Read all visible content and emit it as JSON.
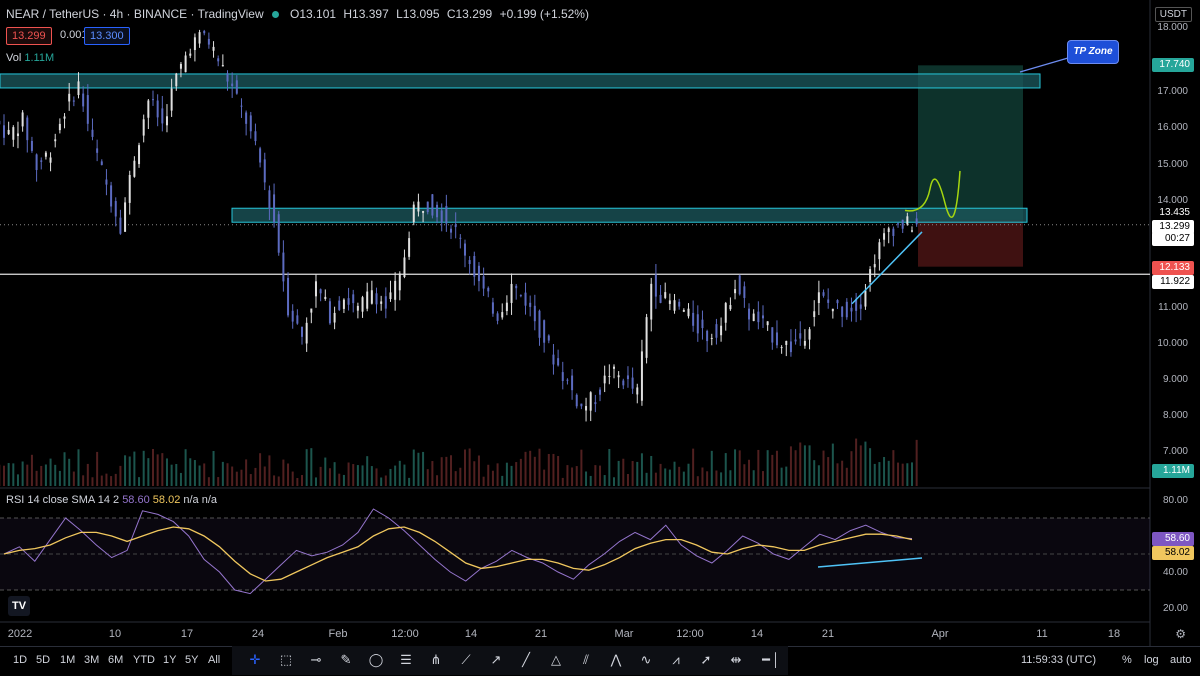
{
  "header": {
    "symbol": "NEAR / TetherUS · 4h · BINANCE · TradingView",
    "open": "O13.101",
    "high": "H13.397",
    "low": "L13.095",
    "close": "C13.299",
    "change": "+0.199 (+1.52%)",
    "sell_price": "13.299",
    "spread": "0.001",
    "buy_price": "13.300",
    "vol_label": "Vol",
    "vol_value": "1.11M",
    "currency": "USDT"
  },
  "rsi": {
    "label": "RSI 14 close SMA 14 2",
    "value": "58.60",
    "sma": "58.02",
    "extra": "n/a n/a"
  },
  "price_axis": [
    "18.000",
    "17.000",
    "16.000",
    "15.000",
    "14.000",
    "11.000",
    "10.000",
    "9.000",
    "8.000",
    "7.000"
  ],
  "rsi_axis": [
    "80.00",
    "40.00",
    "20.00"
  ],
  "price_tags": {
    "tp": "17.740",
    "entry": "13.435",
    "current": "13.299",
    "countdown": "00:27",
    "stop": "12.133",
    "support": "11.922",
    "volume": "1.11M",
    "rsi_value": "58.60",
    "rsi_sma": "58.02"
  },
  "time_axis": [
    "2022",
    "10",
    "17",
    "24",
    "Feb",
    "12:00",
    "14",
    "21",
    "Mar",
    "12:00",
    "14",
    "21",
    "Apr",
    "11",
    "18"
  ],
  "annotation": "TP Zone",
  "toolbar": {
    "timeframes": [
      "1D",
      "5D",
      "1M",
      "3M",
      "6M",
      "YTD",
      "1Y",
      "5Y",
      "All"
    ],
    "clock": "11:59:33 (UTC)",
    "percent": "%",
    "log": "log",
    "auto": "auto"
  },
  "colors": {
    "up": "#26a69a",
    "down": "#5c6bc0",
    "zone": "#26c6da",
    "rsi": "#9575cd",
    "rsi_sma": "#f0c75e"
  },
  "chart_data": {
    "type": "candlestick",
    "ylim": [
      7,
      18.4
    ],
    "price_series": [
      15.8,
      16.2,
      14.9,
      15.4,
      16.5,
      17.2,
      15.6,
      14.4,
      13.3,
      15.2,
      16.8,
      16.1,
      17.4,
      18.3,
      18.6,
      17.9,
      17.1,
      16.2,
      15.0,
      13.4,
      11.0,
      10.2,
      11.6,
      10.8,
      11.3,
      10.9,
      11.5,
      11.0,
      11.8,
      13.8,
      13.9,
      13.6,
      13.1,
      12.3,
      11.4,
      10.8,
      11.6,
      11.2,
      10.4,
      9.6,
      8.9,
      8.2,
      8.5,
      9.2,
      9.0,
      8.6,
      11.7,
      11.2,
      11.0,
      10.6,
      10.2,
      10.5,
      11.7,
      10.8,
      10.5,
      10.1,
      9.9,
      10.3,
      11.3,
      11.0,
      10.9,
      11.2,
      12.4,
      13.2,
      13.3,
      13.299
    ],
    "rsi_series": [
      50,
      54,
      46,
      58,
      70,
      63,
      55,
      48,
      52,
      74,
      72,
      68,
      60,
      47,
      40,
      30,
      28,
      36,
      44,
      52,
      49,
      51,
      55,
      62,
      75,
      70,
      63,
      55,
      47,
      40,
      35,
      42,
      46,
      52,
      48,
      45,
      40,
      36,
      44,
      50,
      57,
      62,
      58,
      66,
      55,
      49,
      45,
      52,
      60,
      56,
      50,
      47,
      54,
      61,
      58,
      63,
      66,
      62,
      59,
      58.6
    ],
    "rsi_sma_series": [
      50,
      52,
      53,
      55,
      59,
      62,
      62,
      60,
      57,
      60,
      63,
      65,
      64,
      60,
      54,
      46,
      39,
      35,
      36,
      40,
      44,
      48,
      51,
      54,
      60,
      64,
      65,
      62,
      57,
      51,
      45,
      42,
      43,
      45,
      47,
      47,
      45,
      42,
      41,
      44,
      48,
      53,
      56,
      58,
      58,
      55,
      51,
      50,
      53,
      55,
      54,
      52,
      52,
      55,
      57,
      59,
      61,
      61,
      60,
      58.02
    ],
    "tp_zone": [
      17.3,
      17.5
    ],
    "resistance_zone": [
      13.7,
      13.9
    ],
    "support_line": 11.922,
    "long_position": {
      "entry": 13.435,
      "target": 17.74,
      "stop": 12.133
    }
  }
}
